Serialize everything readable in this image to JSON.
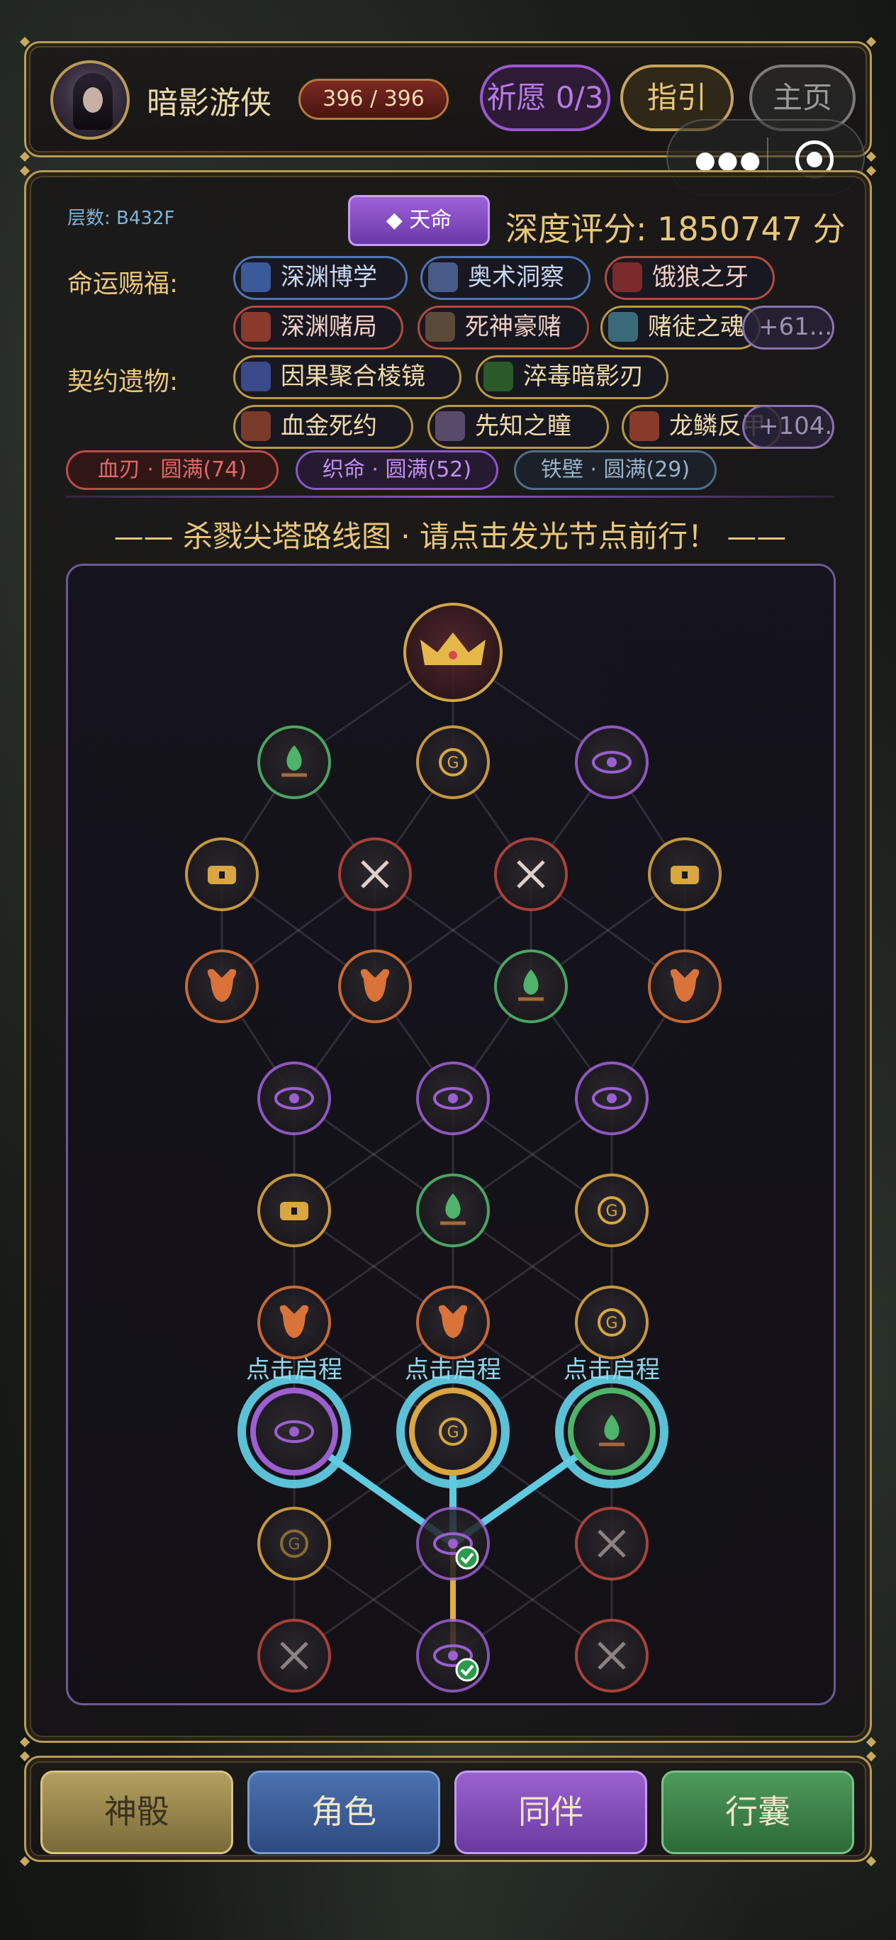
{
  "player": {
    "name": "暗影游侠",
    "hp": "396 / 396"
  },
  "top_buttons": {
    "wish": "祈愿 0/3",
    "guide": "指引",
    "home": "主页"
  },
  "capsule": {
    "menu_icon": "more-dots-icon",
    "close_icon": "record-icon"
  },
  "stats": {
    "floor": "层数: B432F",
    "fate_button": "◆ 天命",
    "depth_score": "深度评分: 1850747 分"
  },
  "blessings": {
    "label": "命运赐福:",
    "items": [
      {
        "name": "深渊博学",
        "style": "blue",
        "icon_color": "#3a5a9a"
      },
      {
        "name": "奥术洞察",
        "style": "blue",
        "icon_color": "#4a5a88"
      },
      {
        "name": "饿狼之牙",
        "style": "red",
        "icon_color": "#7a2a2a"
      },
      {
        "name": "深渊赌局",
        "style": "red",
        "icon_color": "#8a3a2a"
      },
      {
        "name": "死神豪赌",
        "style": "red",
        "icon_color": "#5a4a3a"
      },
      {
        "name": "赌徒之魂",
        "style": "gold",
        "icon_color": "#3a6a7a"
      }
    ],
    "more": "+61..."
  },
  "relics": {
    "label": "契约遗物:",
    "items": [
      {
        "name": "因果聚合棱镜",
        "style": "gold",
        "icon_color": "#3a4a8a"
      },
      {
        "name": "淬毒暗影刃",
        "style": "gold",
        "icon_color": "#2a5a2a"
      },
      {
        "name": "血金死约",
        "style": "gold",
        "icon_color": "#7a3a2a"
      },
      {
        "name": "先知之瞳",
        "style": "gold",
        "icon_color": "#5a4a6a"
      },
      {
        "name": "龙鳞反甲",
        "style": "gold",
        "icon_color": "#8a3a2a"
      }
    ],
    "more": "+104..."
  },
  "sets": {
    "red": "血刃 · 圆满(74)",
    "purple": "织命 · 圆满(52)",
    "grey": "铁壁 · 圆满(29)"
  },
  "map": {
    "title": "—— 杀戮尖塔路线图 · 请点击发光节点前行！ ——",
    "start_label": "点击启程",
    "colors": {
      "elite": "#b8473f",
      "shop": "#d9a640",
      "event": "#9b5fd0",
      "rest": "#4fb36a",
      "treasure": "#d9a640",
      "monster": "#d9733a",
      "boss": "#e5b84a",
      "path_glow": "#5fcbe0",
      "path_gold": "#e0b140"
    },
    "rows": [
      [
        "boss"
      ],
      [
        "rest",
        "shop",
        "event"
      ],
      [
        "treasure",
        "elite",
        "elite",
        "treasure"
      ],
      [
        "monster",
        "monster",
        "rest",
        "monster"
      ],
      [
        "event",
        "event",
        "event"
      ],
      [
        "treasure",
        "rest",
        "shop"
      ],
      [
        "monster",
        "monster",
        "shop"
      ],
      [
        "event",
        "shop",
        "rest"
      ],
      [
        "shop",
        "event",
        "elite"
      ],
      [
        "elite",
        "event",
        "elite"
      ]
    ]
  },
  "footer": {
    "dice": "神骰",
    "character": "角色",
    "companion": "同伴",
    "bag": "行囊"
  }
}
